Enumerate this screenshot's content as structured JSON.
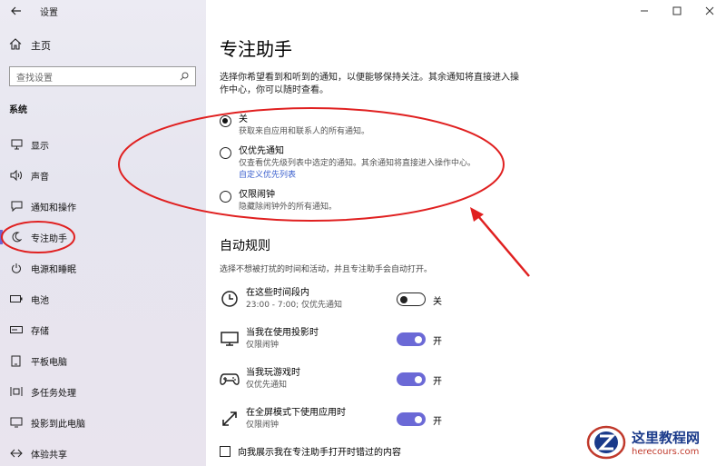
{
  "window": {
    "title": "设置",
    "controls": [
      "minimize",
      "maximize",
      "close"
    ]
  },
  "sidebar": {
    "home_label": "主页",
    "search_placeholder": "查找设置",
    "section_label": "系统",
    "items": [
      {
        "label": "显示",
        "icon": "display-icon"
      },
      {
        "label": "声音",
        "icon": "speaker-icon"
      },
      {
        "label": "通知和操作",
        "icon": "notification-icon"
      },
      {
        "label": "专注助手",
        "icon": "moon-icon",
        "active": true
      },
      {
        "label": "电源和睡眠",
        "icon": "power-icon"
      },
      {
        "label": "电池",
        "icon": "battery-icon"
      },
      {
        "label": "存储",
        "icon": "storage-icon"
      },
      {
        "label": "平板电脑",
        "icon": "tablet-icon"
      },
      {
        "label": "多任务处理",
        "icon": "multitask-icon"
      },
      {
        "label": "投影到此电脑",
        "icon": "project-icon"
      },
      {
        "label": "体验共享",
        "icon": "share-icon"
      }
    ]
  },
  "main": {
    "title": "专注助手",
    "description": "选择你希望看到和听到的通知，以便能够保持关注。其余通知将直接进入操作中心，你可以随时查看。",
    "options": [
      {
        "label": "关",
        "sub": "获取来自应用和联系人的所有通知。",
        "selected": true
      },
      {
        "label": "仅优先通知",
        "sub": "仅查看优先级列表中选定的通知。其余通知将直接进入操作中心。",
        "link": "自定义优先列表",
        "selected": false
      },
      {
        "label": "仅限闹钟",
        "sub": "隐藏除闹钟外的所有通知。",
        "selected": false
      }
    ],
    "auto_rules_title": "自动规则",
    "auto_rules_desc": "选择不想被打扰的时间和活动，并且专注助手会自动打开。",
    "rules": [
      {
        "name": "在这些时间段内",
        "sub": "23:00 - 7:00; 仅优先通知",
        "state": "关",
        "on": false,
        "icon": "clock-icon"
      },
      {
        "name": "当我在使用投影时",
        "sub": "仅限闹钟",
        "state": "开",
        "on": true,
        "icon": "monitor-icon"
      },
      {
        "name": "当我玩游戏时",
        "sub": "仅优先通知",
        "state": "开",
        "on": true,
        "icon": "gamepad-icon"
      },
      {
        "name": "在全屏模式下使用应用时",
        "sub": "仅限闹钟",
        "state": "开",
        "on": true,
        "icon": "fullscreen-icon"
      }
    ],
    "checkbox_label": "向我展示我在专注助手打开时错过的内容"
  },
  "watermark": {
    "title": "这里教程网",
    "url": "herecours.com"
  },
  "colors": {
    "accent": "#6b69d6",
    "annotation": "#e02020",
    "link": "#3a5fcd"
  }
}
